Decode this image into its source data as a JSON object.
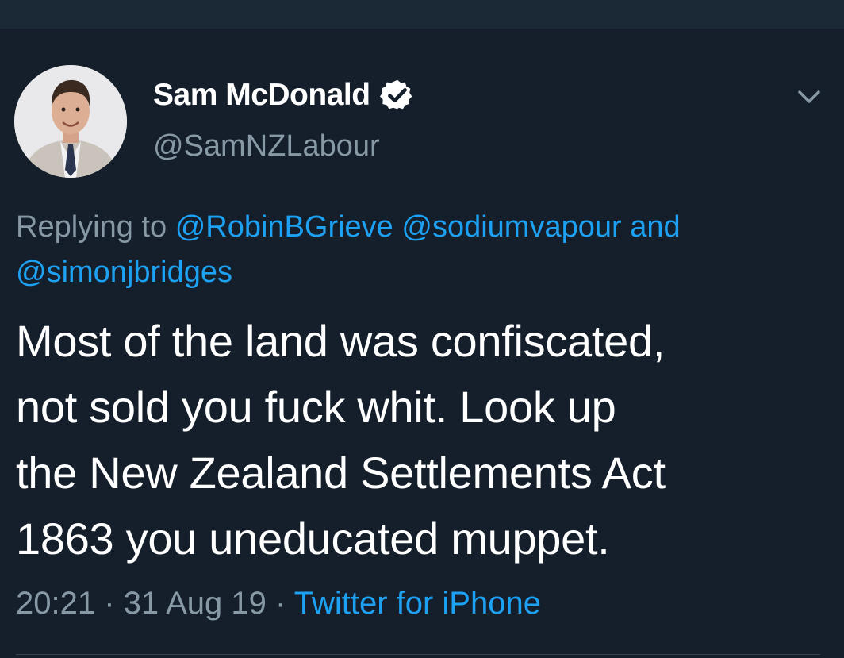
{
  "tweet": {
    "author": {
      "display_name": "Sam McDonald",
      "handle": "@SamNZLabour",
      "verified": true
    },
    "reply": {
      "prefix": "Replying to",
      "mentions": [
        "@RobinBGrieve",
        "@sodiumvapour",
        "@simonjbridges"
      ],
      "conjunction": "and"
    },
    "text_lines": [
      "Most of the land was confiscated,",
      "not sold you fuck whit. Look up",
      "the New Zealand Settlements Act",
      "1863 you uneducated muppet."
    ],
    "time": "20:21",
    "date": "31 Aug 19",
    "separator": "·",
    "source": "Twitter for iPhone"
  },
  "colors": {
    "background": "#151f2b",
    "accent": "#1da1f2",
    "secondary_text": "#8899a6",
    "primary_text": "#ffffff"
  },
  "icons": {
    "verified": "verified-badge-icon",
    "more": "chevron-down-icon"
  }
}
